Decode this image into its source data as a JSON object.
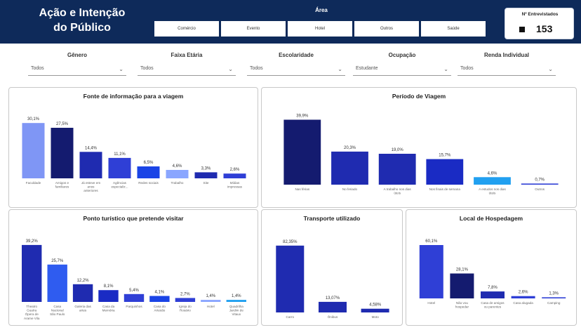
{
  "header": {
    "title_line1": "Ação e Intenção",
    "title_line2": "do Público",
    "area_label": "Área",
    "area_buttons": [
      "Comércio",
      "Evento",
      "Hotel",
      "Outros",
      "Saúde"
    ],
    "kpi_label": "Nº Entrevistados",
    "kpi_value": "153"
  },
  "filters": [
    {
      "label": "Gênero",
      "value": "Todos"
    },
    {
      "label": "Faixa Etária",
      "value": "Todos"
    },
    {
      "label": "Escolaridade",
      "value": "Todos"
    },
    {
      "label": "Ocupação",
      "value": "Estudante"
    },
    {
      "label": "Renda Individual",
      "value": "Todos"
    }
  ],
  "colors": {
    "header_bg": "#0e2a5a",
    "light_blue": "#7f96f5",
    "navy": "#141b6f",
    "dark_blue": "#1f2bb0",
    "mid_blue": "#2f3fd6",
    "royal_blue": "#1a44e6",
    "periwinkle": "#8aa6ff",
    "sky_blue": "#21a0f0"
  },
  "chart_data": [
    {
      "type": "bar",
      "title": "Fonte de informação para a viagem",
      "categories": [
        "Faculdade",
        "Amigos e familiares",
        "Já esteve em anos anteriores",
        "Agências especializ...",
        "Redes sociais",
        "Trabalho",
        "Site",
        "Mídias impressas"
      ],
      "values": [
        30.1,
        27.5,
        14.4,
        11.1,
        6.5,
        4.6,
        3.3,
        2.6
      ],
      "value_labels": [
        "30,1%",
        "27,5%",
        "14,4%",
        "11,1%",
        "6,5%",
        "4,6%",
        "3,3%",
        "2,6%"
      ],
      "colors": [
        "#7f96f5",
        "#141b6f",
        "#1f2bb0",
        "#2f3fd6",
        "#1a44e6",
        "#8aa6ff",
        "#1f2bb0",
        "#2f3fd6"
      ],
      "ylim": [
        0,
        34
      ]
    },
    {
      "type": "bar",
      "title": "Período de Viagem",
      "categories": [
        "Nas férias",
        "No feriado",
        "A trabalho nos dias úteis",
        "Nos finais de semana",
        "A estudos nos dias úteis",
        "Outros"
      ],
      "values": [
        39.9,
        20.3,
        19.0,
        15.7,
        4.6,
        0.7
      ],
      "value_labels": [
        "39,9%",
        "20,3%",
        "19,0%",
        "15,7%",
        "4,6%",
        "0,7%"
      ],
      "colors": [
        "#141b6f",
        "#1f2bb0",
        "#1f2bb0",
        "#1a2bc4",
        "#21a0f0",
        "#2f3fd6"
      ],
      "ylim": [
        0,
        44
      ]
    },
    {
      "type": "bar",
      "title": "Ponto turístico que pretende visitar",
      "categories": [
        "Theatro Guaíra Ópera de Arame Vila Viva",
        "Casa Nacional São Paulo",
        "Galeria das artes",
        "Casa da Memória",
        "Parquinhos",
        "Casa do Artesão",
        "Igreja do Rosário",
        "Hotel",
        "Quadrilha Jardim de Vitaux"
      ],
      "values": [
        39.2,
        25.7,
        12.2,
        8.1,
        5.4,
        4.1,
        2.7,
        1.4,
        1.4
      ],
      "value_labels": [
        "39,2%",
        "25,7%",
        "12,2%",
        "8,1%",
        "5,4%",
        "4,1%",
        "2,7%",
        "1,4%",
        "1,4%"
      ],
      "colors": [
        "#1f2bb0",
        "#2f5cf0",
        "#1f2bb0",
        "#1a2bc4",
        "#2f3fd6",
        "#1a44e6",
        "#2f3fd6",
        "#8aa6ff",
        "#21a0f0"
      ],
      "ylim": [
        0,
        44
      ]
    },
    {
      "type": "bar",
      "title": "Transporte utilizado",
      "categories": [
        "Carro",
        "Ônibus",
        "Moto"
      ],
      "values": [
        82.35,
        13.07,
        4.58
      ],
      "value_labels": [
        "82,35%",
        "13,07%",
        "4,58%"
      ],
      "colors": [
        "#1f2bb0",
        "#1f2bb0",
        "#1f2bb0"
      ],
      "ylim": [
        0,
        90
      ]
    },
    {
      "type": "bar",
      "title": "Local de Hospedagem",
      "categories": [
        "Hotel",
        "Não vou hospedar",
        "Casa de amigos ou parentes",
        "Casa alugada",
        "Camping"
      ],
      "values": [
        60.1,
        28.1,
        7.8,
        2.6,
        1.3
      ],
      "value_labels": [
        "60,1%",
        "28,1%",
        "7,8%",
        "2,6%",
        "1,3%"
      ],
      "colors": [
        "#2f3fd6",
        "#141b6f",
        "#1f2bb0",
        "#2f3fd6",
        "#2f3fd6"
      ],
      "ylim": [
        0,
        68
      ]
    }
  ]
}
